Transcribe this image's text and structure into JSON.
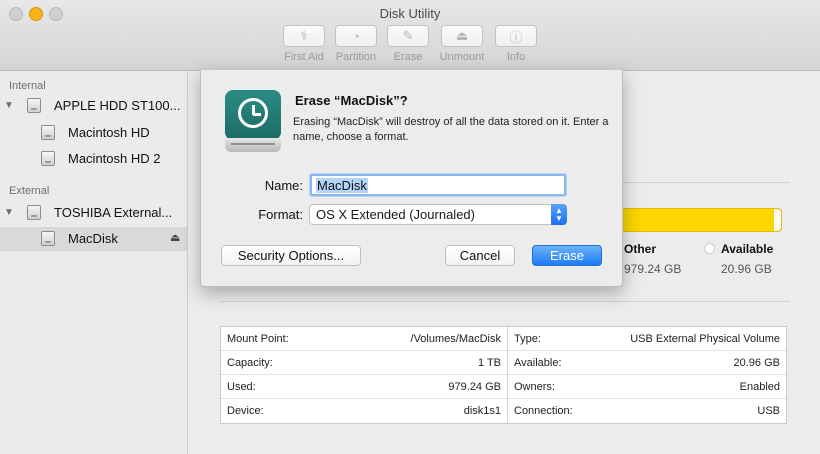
{
  "window": {
    "title": "Disk Utility"
  },
  "toolbar": {
    "items": [
      {
        "label": "First Aid",
        "icon": "stethoscope-icon"
      },
      {
        "label": "Partition",
        "icon": "pie-chart-icon"
      },
      {
        "label": "Erase",
        "icon": "eraser-icon"
      },
      {
        "label": "Unmount",
        "icon": "unmount-icon"
      },
      {
        "label": "Info",
        "icon": "info-icon"
      }
    ]
  },
  "sidebar": {
    "internal_heading": "Internal",
    "external_heading": "External",
    "internal_items": [
      {
        "label": "APPLE HDD ST100..."
      },
      {
        "label": "Macintosh HD"
      },
      {
        "label": "Macintosh HD 2"
      }
    ],
    "external_items": [
      {
        "label": "TOSHIBA External..."
      },
      {
        "label": "MacDisk",
        "selected": true
      }
    ]
  },
  "usage": {
    "other_label": "Other",
    "other_value": "979.24 GB",
    "available_label": "Available",
    "available_value": "20.96 GB",
    "bar_color": "#FDD500",
    "used_fraction": 0.979
  },
  "info": {
    "left": [
      {
        "label": "Mount Point:",
        "value": "/Volumes/MacDisk"
      },
      {
        "label": "Capacity:",
        "value": "1 TB"
      },
      {
        "label": "Used:",
        "value": "979.24 GB"
      },
      {
        "label": "Device:",
        "value": "disk1s1"
      }
    ],
    "right": [
      {
        "label": "Type:",
        "value": "USB External Physical Volume"
      },
      {
        "label": "Available:",
        "value": "20.96 GB"
      },
      {
        "label": "Owners:",
        "value": "Enabled"
      },
      {
        "label": "Connection:",
        "value": "USB"
      }
    ]
  },
  "sheet": {
    "title": "Erase “MacDisk”?",
    "message": "Erasing “MacDisk” will destroy of all the data stored on it. Enter a name, choose a format.",
    "name_label": "Name:",
    "name_value": "MacDisk",
    "format_label": "Format:",
    "format_value": "OS X Extended (Journaled)",
    "security_button": "Security Options...",
    "cancel_button": "Cancel",
    "erase_button": "Erase",
    "accent_color": "#1B7BF5"
  }
}
